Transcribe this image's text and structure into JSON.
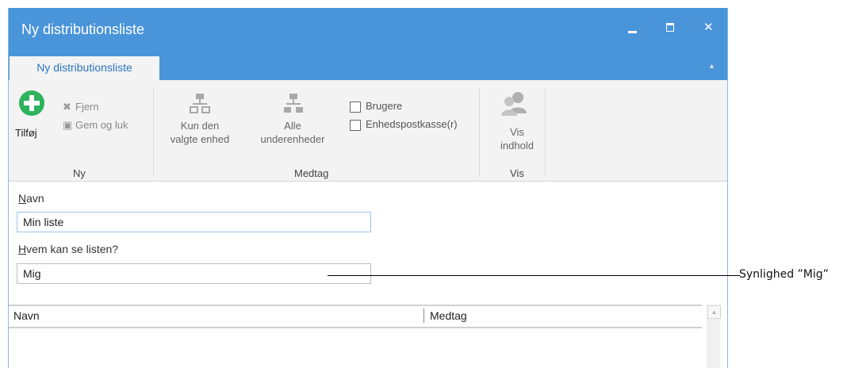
{
  "window": {
    "title": "Ny distributionsliste",
    "controls": {
      "minimize": "minimize",
      "maximize": "maximize",
      "close": "✕"
    }
  },
  "ribbon": {
    "tab_label": "Ny distributionsliste",
    "collapse_glyph": "︿",
    "groups": {
      "ny": {
        "label": "Ny",
        "add_label": "Tilføj",
        "remove_label": "Fjern",
        "save_close_label": "Gem og luk"
      },
      "medtag": {
        "label": "Medtag",
        "selected_unit_line1": "Kun den",
        "selected_unit_line2": "valgte enhed",
        "all_subunits_line1": "Alle",
        "all_subunits_line2": "underenheder",
        "checkbox_users": "Brugere",
        "checkbox_unit_mailbox": "Enhedspostkasse(r)"
      },
      "vis": {
        "label": "Vis",
        "show_content_line1": "Vis",
        "show_content_line2": "indhold"
      }
    }
  },
  "form": {
    "name_label_first": "N",
    "name_label_rest": "avn",
    "name_value": "Min liste",
    "visibility_label_first": "H",
    "visibility_label_rest": "vem kan se listen?",
    "visibility_value": "Mig"
  },
  "grid": {
    "columns": [
      "Navn",
      "Medtag"
    ]
  },
  "callout": {
    "text": "Synlighed ”Mig”"
  },
  "colors": {
    "titlebar": "#4a94da",
    "ribbon_bg": "#f3f3f3",
    "tab_text": "#2e74c0",
    "add_icon_green": "#2db35c"
  }
}
